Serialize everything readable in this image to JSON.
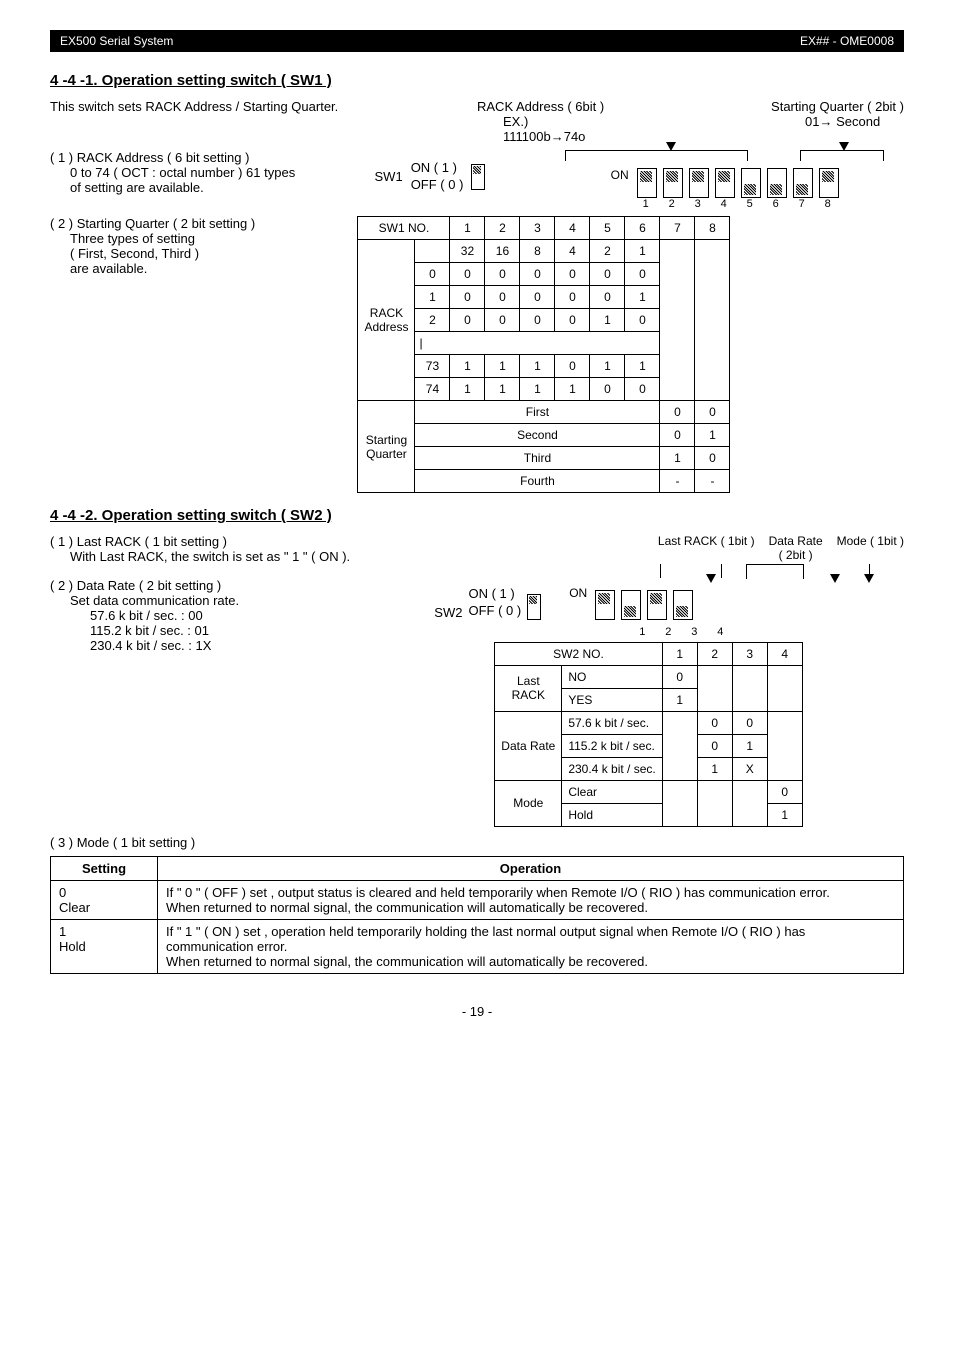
{
  "header": {
    "left": "EX500 Serial System",
    "right": "EX## - OME0008"
  },
  "sec441": {
    "title": "4 -4 -1. Operation setting switch ( SW1 )",
    "intro": "This switch sets RACK Address / Starting Quarter.",
    "p1a": "( 1 ) RACK Address ( 6 bit setting )",
    "p1b": "0 to 74 ( OCT : octal number ) 61 types",
    "p1c": "of setting are available.",
    "p2a": "( 2 ) Starting Quarter ( 2 bit setting )",
    "p2b": "Three types of setting",
    "p2c": "( First, Second, Third )",
    "p2d": "are available.",
    "sw_label": "SW1",
    "on_label": "ON ( 1 )",
    "off_label": "OFF ( 0 )",
    "dip_on": "ON",
    "rack_addr_label": "RACK Address ( 6bit )",
    "ex_label": "EX.)",
    "ex_value": "111100b→74o",
    "start_q_label": "Starting Quarter ( 2bit )",
    "start_q_example": "01→  Second",
    "sw_box_header": "SW1 NO.",
    "rack_addr_rowlabel": "RACK\nAddress",
    "start_q_rowlabel": "Starting\nQuarter",
    "nums": [
      "1",
      "2",
      "3",
      "4",
      "5",
      "6",
      "7",
      "8"
    ],
    "row_weights": [
      "32",
      "16",
      "8",
      "4",
      "2",
      "1",
      "",
      ""
    ],
    "rack_rows": [
      [
        "0",
        "0",
        "0",
        "0",
        "0",
        "0",
        "0",
        "",
        ""
      ],
      [
        "1",
        "0",
        "0",
        "0",
        "0",
        "0",
        "1",
        "",
        ""
      ],
      [
        "2",
        "0",
        "0",
        "0",
        "0",
        "1",
        "0",
        "",
        ""
      ]
    ],
    "rack_dots": "|",
    "rack_rows_end": [
      [
        "73",
        "1",
        "1",
        "1",
        "0",
        "1",
        "1",
        "",
        ""
      ],
      [
        "74",
        "1",
        "1",
        "1",
        "1",
        "0",
        "0",
        "",
        ""
      ]
    ],
    "quarter_rows": [
      [
        "First",
        "0",
        "0"
      ],
      [
        "Second",
        "0",
        "1"
      ],
      [
        "Third",
        "1",
        "0"
      ],
      [
        "Fourth",
        "-",
        "-"
      ]
    ]
  },
  "sec442": {
    "title": "4 -4 -2. Operation setting switch ( SW2 )",
    "p1a": "( 1 ) Last RACK ( 1 bit setting )",
    "p1b": "With Last RACK, the switch is set as \" 1 \" ( ON ).",
    "p2a": "( 2 ) Data Rate ( 2 bit setting )",
    "p2b": "Set data communication rate.",
    "rate1": "57.6 k bit / sec.  :  00",
    "rate2": "115.2 k bit / sec.  :  01",
    "rate3": "230.4 k bit / sec.  :  1X",
    "p3": "( 3 ) Mode ( 1 bit setting )",
    "sw_label": "SW2",
    "on_label": "ON ( 1 )",
    "off_label": "OFF ( 0 )",
    "dip_on": "ON",
    "last_rack_label": "Last RACK ( 1bit )",
    "data_rate_label": "Data Rate\n( 2bit )",
    "mode_label": "Mode ( 1bit )",
    "sw_box_header": "SW2 NO.",
    "nums": [
      "1",
      "2",
      "3",
      "4"
    ],
    "tbl_last_rack": "Last\nRACK",
    "tbl_data_rate": "Data Rate",
    "tbl_mode": "Mode",
    "r_no": "NO",
    "r_yes": "YES",
    "r_576": "57.6 k bit / sec.",
    "r_1152": "115.2 k bit / sec.",
    "r_2304": "230.4 k bit / sec.",
    "r_clear": "Clear",
    "r_hold": "Hold",
    "vals": {
      "no": "0",
      "yes": "1",
      "576_2": "0",
      "576_3": "0",
      "1152_2": "0",
      "1152_3": "1",
      "2304_2": "1",
      "2304_3": "X",
      "clear_4": "0",
      "hold_4": "1"
    }
  },
  "settings_table": {
    "h1": "Setting",
    "h2": "Operation",
    "r1_setting": "0\nClear",
    "r1_op": "If \" 0 \" ( OFF ) set , output status is cleared and held temporarily when Remote I/O ( RIO ) has communication error.\nWhen returned to normal signal, the communication will automatically be recovered.",
    "r2_setting": "1\nHold",
    "r2_op": "If \" 1 \" ( ON ) set , operation held temporarily holding the last normal output signal when Remote I/O ( RIO ) has communication error.\nWhen returned to normal signal, the communication will automatically be recovered."
  },
  "footer": {
    "page": "- 19 -"
  },
  "chart_data": [
    {
      "type": "table",
      "title": "SW1 RACK Address / Starting Quarter truth table",
      "columns": [
        "SW1 NO.",
        "1",
        "2",
        "3",
        "4",
        "5",
        "6",
        "7",
        "8"
      ],
      "bit_weights": {
        "1": 32,
        "2": 16,
        "3": 8,
        "4": 4,
        "5": 2,
        "6": 1
      },
      "rack_address_rows": [
        {
          "addr": 0,
          "bits": [
            0,
            0,
            0,
            0,
            0,
            0
          ]
        },
        {
          "addr": 1,
          "bits": [
            0,
            0,
            0,
            0,
            0,
            1
          ]
        },
        {
          "addr": 2,
          "bits": [
            0,
            0,
            0,
            0,
            1,
            0
          ]
        },
        {
          "addr": 73,
          "bits": [
            1,
            1,
            1,
            0,
            1,
            1
          ]
        },
        {
          "addr": 74,
          "bits": [
            1,
            1,
            1,
            1,
            0,
            0
          ]
        }
      ],
      "starting_quarter_rows": [
        {
          "name": "First",
          "bit7": 0,
          "bit8": 0
        },
        {
          "name": "Second",
          "bit7": 0,
          "bit8": 1
        },
        {
          "name": "Third",
          "bit7": 1,
          "bit8": 0
        },
        {
          "name": "Fourth",
          "bit7": "-",
          "bit8": "-"
        }
      ]
    },
    {
      "type": "table",
      "title": "SW2 Last RACK / Data Rate / Mode truth table",
      "columns": [
        "SW2 NO.",
        "1",
        "2",
        "3",
        "4"
      ],
      "rows": [
        {
          "group": "Last RACK",
          "label": "NO",
          "1": 0
        },
        {
          "group": "Last RACK",
          "label": "YES",
          "1": 1
        },
        {
          "group": "Data Rate",
          "label": "57.6 k bit / sec.",
          "2": 0,
          "3": 0
        },
        {
          "group": "Data Rate",
          "label": "115.2 k bit / sec.",
          "2": 0,
          "3": 1
        },
        {
          "group": "Data Rate",
          "label": "230.4 k bit / sec.",
          "2": 1,
          "3": "X"
        },
        {
          "group": "Mode",
          "label": "Clear",
          "4": 0
        },
        {
          "group": "Mode",
          "label": "Hold",
          "4": 1
        }
      ]
    }
  ]
}
